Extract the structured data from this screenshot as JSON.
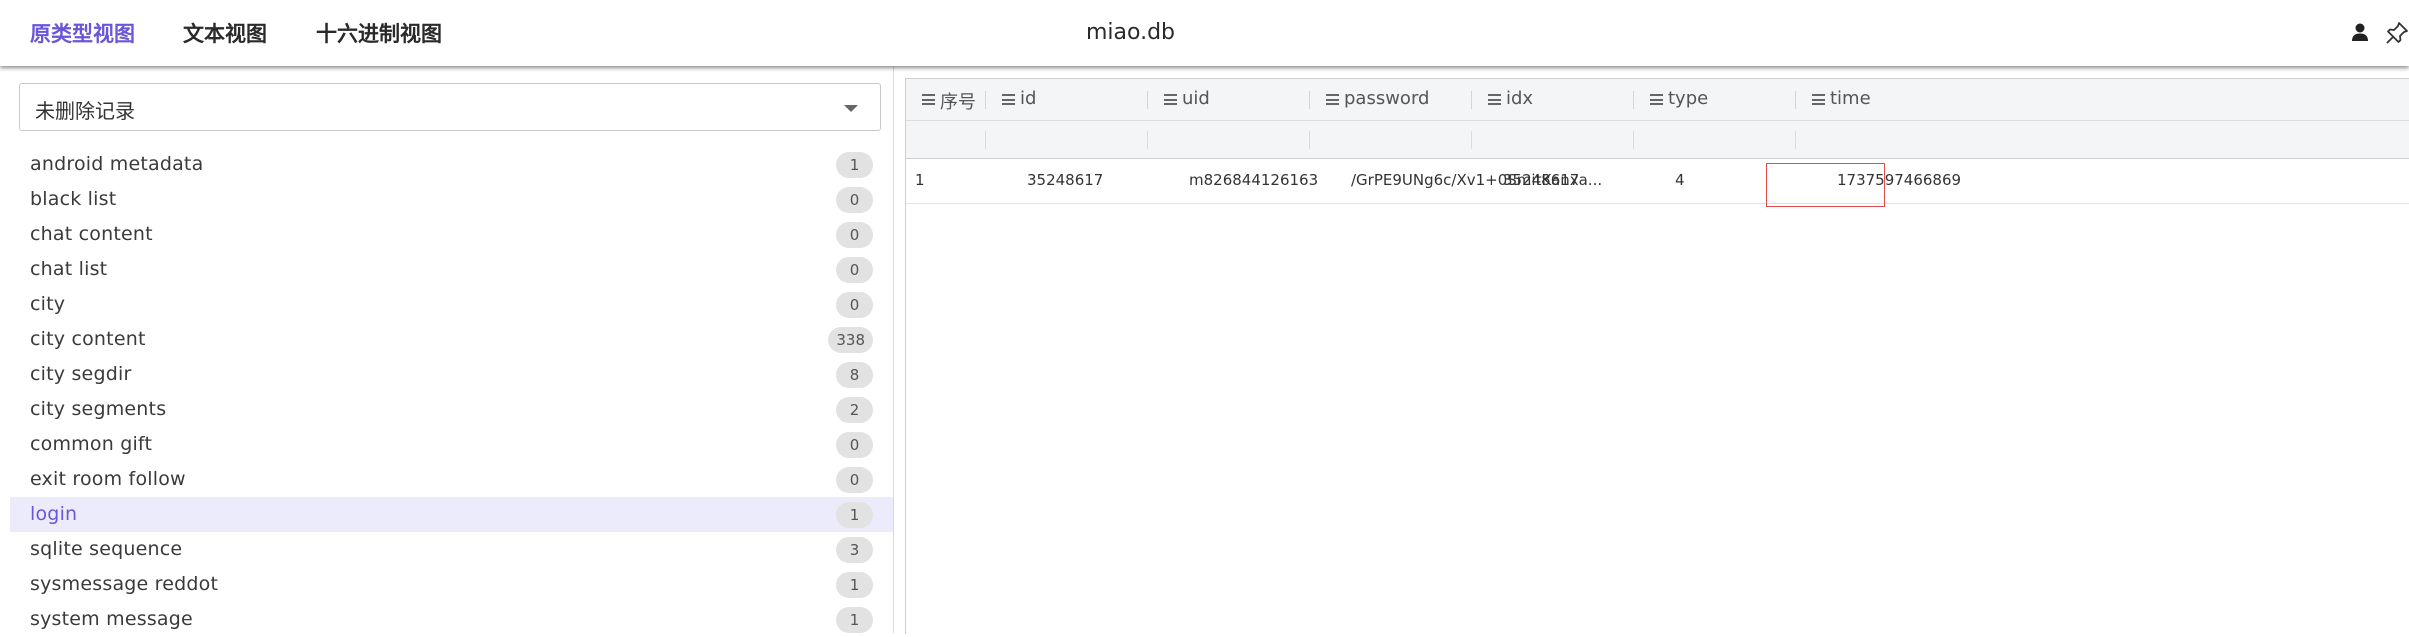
{
  "tabs": [
    {
      "label": "原类型视图",
      "active": true
    },
    {
      "label": "文本视图",
      "active": false
    },
    {
      "label": "十六进制视图",
      "active": false
    }
  ],
  "filename": "miao.db",
  "dropdown": {
    "value": "未删除记录"
  },
  "tables": [
    {
      "name": "android metadata",
      "count": "1"
    },
    {
      "name": "black list",
      "count": "0"
    },
    {
      "name": "chat content",
      "count": "0"
    },
    {
      "name": "chat list",
      "count": "0"
    },
    {
      "name": "city",
      "count": "0"
    },
    {
      "name": "city content",
      "count": "338"
    },
    {
      "name": "city segdir",
      "count": "8"
    },
    {
      "name": "city segments",
      "count": "2"
    },
    {
      "name": "common gift",
      "count": "0"
    },
    {
      "name": "exit room follow",
      "count": "0"
    },
    {
      "name": "login",
      "count": "1",
      "selected": true
    },
    {
      "name": "sqlite sequence",
      "count": "3"
    },
    {
      "name": "sysmessage reddot",
      "count": "1"
    },
    {
      "name": "system message",
      "count": "1"
    }
  ],
  "grid": {
    "columns": [
      "序号",
      "id",
      "uid",
      "password",
      "idx",
      "type",
      "time"
    ],
    "rows": [
      [
        "1",
        "35248617",
        "m826844126163",
        "/GrPE9UNg6c/Xv1+0SmitKanxa...",
        "35248617",
        "4",
        "1737597466869"
      ]
    ],
    "highlighted_cell": {
      "row": 0,
      "column": "idx"
    }
  },
  "colors": {
    "accent": "#6a56d8",
    "selected_bg": "#ecebfc",
    "highlight_border": "#e04b4b"
  },
  "icons": {
    "user": "user-icon",
    "pin": "pin-icon",
    "column_menu": "menu-icon",
    "dropdown": "caret-down-icon"
  }
}
